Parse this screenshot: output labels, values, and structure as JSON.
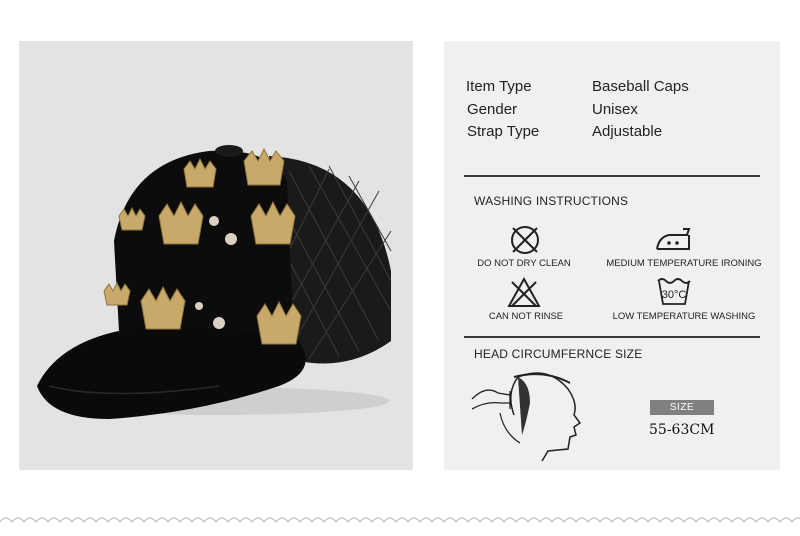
{
  "specs": [
    {
      "label": "Item Type",
      "value": "Baseball Caps"
    },
    {
      "label": "Gender",
      "value": "Unisex"
    },
    {
      "label": "Strap Type",
      "value": "Adjustable"
    }
  ],
  "washing": {
    "title": "WASHING INSTRUCTIONS",
    "items": [
      {
        "label": "DO NOT DRY CLEAN",
        "icon": "no-dry-clean-icon"
      },
      {
        "label": "MEDIUM TEMPERATURE IRONING",
        "icon": "iron-icon"
      },
      {
        "label": "CAN NOT RINSE",
        "icon": "no-rinse-icon"
      },
      {
        "label": "LOW TEMPERATURE WASHING",
        "icon": "wash-30-icon",
        "temp": "30°C"
      }
    ]
  },
  "head": {
    "title": "HEAD CIRCUMFERNCE SIZE",
    "size_label": "SIZE",
    "size_value": "55-63CM"
  },
  "colors": {
    "cap": "#0c0c0c",
    "crown_gold": "#c8a96a",
    "panel_bg": "#f0f0f0",
    "photo_bg": "#e3e3e3",
    "badge": "#808080"
  }
}
